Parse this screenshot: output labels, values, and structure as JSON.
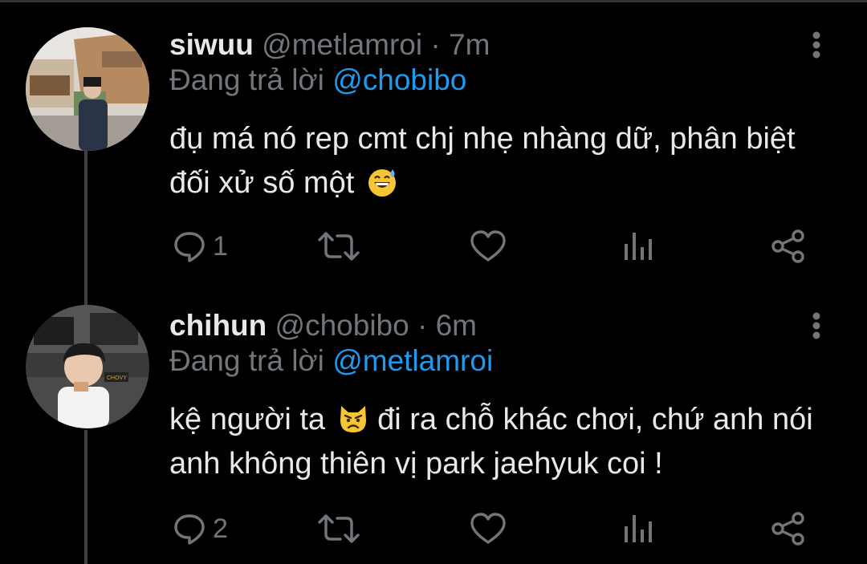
{
  "colors": {
    "background": "#000000",
    "accent": "#1d9bf0",
    "muted": "#71767b",
    "text": "#e7e9ea"
  },
  "tweets": [
    {
      "name": "siwuu",
      "handle": "@metlamroi",
      "separator": "·",
      "time": "7m",
      "reply_prefix": "Đang trả lời",
      "reply_to": "@chobibo",
      "text_before": "đụ má nó rep cmt chj nhẹ nhàng dữ, phân biệt đối xử số một",
      "emoji": "grinning-face-with-sweat",
      "text_after": "",
      "reply_count": "1"
    },
    {
      "name": "chihun",
      "handle": "@chobibo",
      "separator": "·",
      "time": "6m",
      "reply_prefix": "Đang trả lời",
      "reply_to": "@metlamroi",
      "text_before": "kệ người ta",
      "emoji": "pouting-cat",
      "text_after": "đi ra chỗ khác chơi, chứ anh nói anh không thiên vị park jaehyuk coi !",
      "reply_count": "2"
    }
  ],
  "action_icons": [
    "reply-icon",
    "retweet-icon",
    "like-icon",
    "views-icon",
    "share-icon"
  ]
}
